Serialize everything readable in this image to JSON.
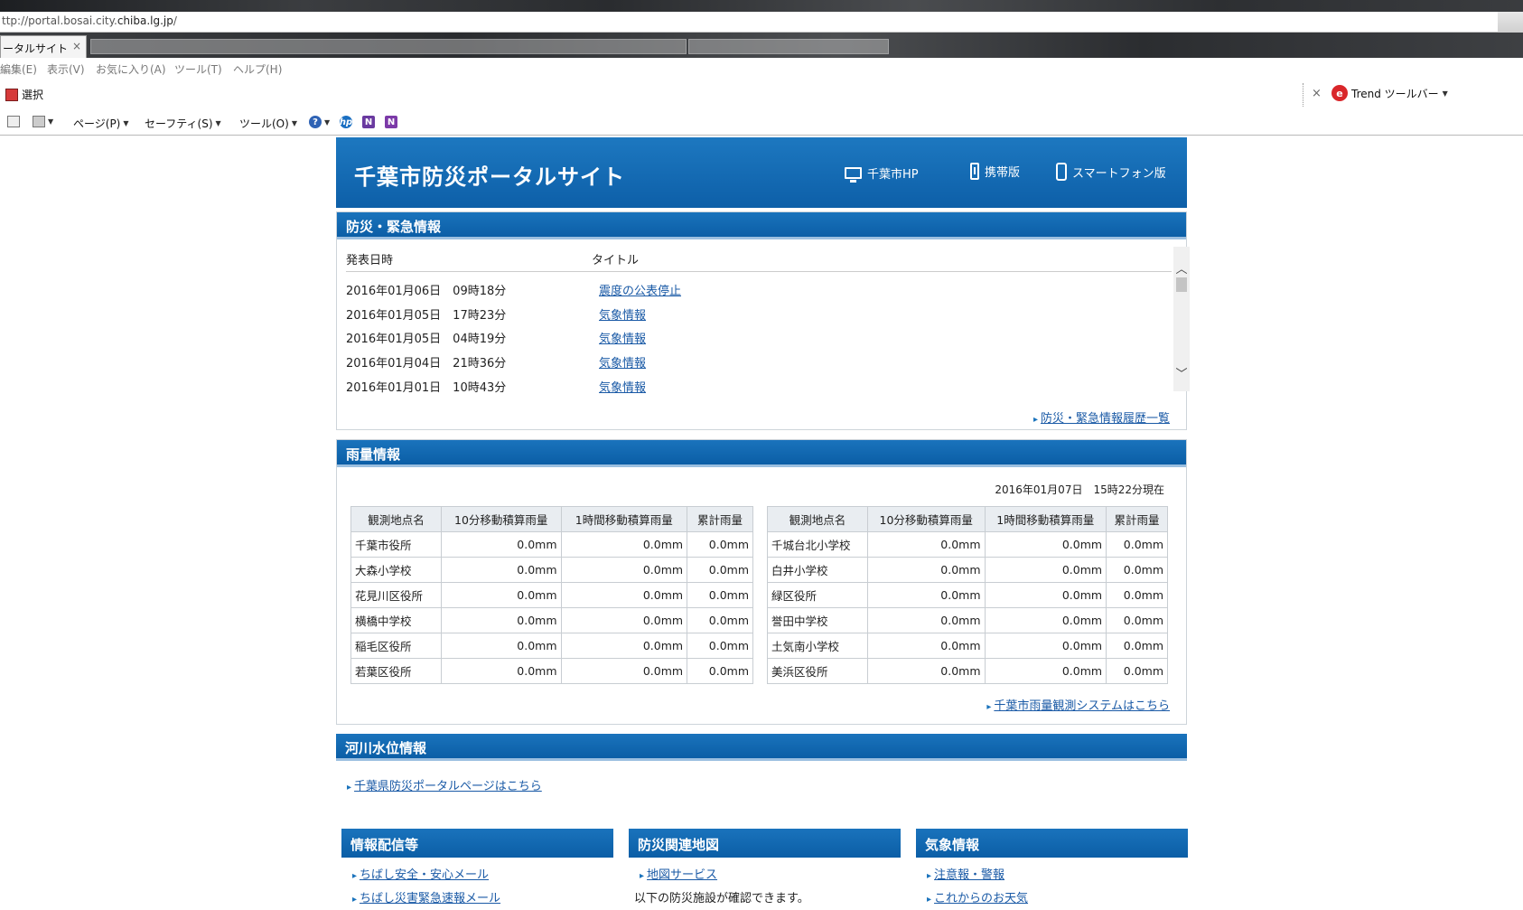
{
  "browser": {
    "url_prefix": "ttp://portal.bosai.city.",
    "url_host": "chiba.lg.jp",
    "url_suffix": "/",
    "tab_title": "ータルサイト",
    "tab_close": "×",
    "menu": [
      "編集(E)",
      "表示(V)",
      "お気に入り(A)",
      "ツール(T)",
      "ヘルプ(H)"
    ],
    "select_label": "選択",
    "close_x": "×",
    "trend_label": "Trend ツールバー",
    "cmd": {
      "page": "ページ(P)",
      "safety": "セーフティ(S)",
      "tools": "ツール(O)",
      "help": "?"
    }
  },
  "site": {
    "title": "千葉市防災ポータルサイト",
    "nav": {
      "hp": "千葉市HP",
      "mobile": "携帯版",
      "smartphone": "スマートフォン版"
    }
  },
  "emergency": {
    "heading": "防災・緊急情報",
    "col_date": "発表日時",
    "col_title": "タイトル",
    "rows": [
      {
        "date": "2016年01月06日　09時18分",
        "title": "震度の公表停止"
      },
      {
        "date": "2016年01月05日　17時23分",
        "title": "気象情報"
      },
      {
        "date": "2016年01月05日　04時19分",
        "title": "気象情報"
      },
      {
        "date": "2016年01月04日　21時36分",
        "title": "気象情報"
      },
      {
        "date": "2016年01月01日　10時43分",
        "title": "気象情報"
      }
    ],
    "more": "防災・緊急情報履歴一覧"
  },
  "rain": {
    "heading": "雨量情報",
    "timestamp": "2016年01月07日　15時22分現在",
    "headers": [
      "観測地点名",
      "10分移動積算雨量",
      "1時間移動積算雨量",
      "累計雨量"
    ],
    "left": [
      [
        "千葉市役所",
        "0.0mm",
        "0.0mm",
        "0.0mm"
      ],
      [
        "大森小学校",
        "0.0mm",
        "0.0mm",
        "0.0mm"
      ],
      [
        "花見川区役所",
        "0.0mm",
        "0.0mm",
        "0.0mm"
      ],
      [
        "横橋中学校",
        "0.0mm",
        "0.0mm",
        "0.0mm"
      ],
      [
        "稲毛区役所",
        "0.0mm",
        "0.0mm",
        "0.0mm"
      ],
      [
        "若葉区役所",
        "0.0mm",
        "0.0mm",
        "0.0mm"
      ]
    ],
    "right": [
      [
        "千城台北小学校",
        "0.0mm",
        "0.0mm",
        "0.0mm"
      ],
      [
        "白井小学校",
        "0.0mm",
        "0.0mm",
        "0.0mm"
      ],
      [
        "緑区役所",
        "0.0mm",
        "0.0mm",
        "0.0mm"
      ],
      [
        "誉田中学校",
        "0.0mm",
        "0.0mm",
        "0.0mm"
      ],
      [
        "土気南小学校",
        "0.0mm",
        "0.0mm",
        "0.0mm"
      ],
      [
        "美浜区役所",
        "0.0mm",
        "0.0mm",
        "0.0mm"
      ]
    ],
    "more": "千葉市雨量観測システムはこちら"
  },
  "river": {
    "heading": "河川水位情報",
    "link": "千葉県防災ポータルページはこちら"
  },
  "columns": {
    "info": {
      "heading": "情報配信等",
      "links": [
        "ちばし安全・安心メール",
        "ちばし災害緊急速報メール"
      ]
    },
    "map": {
      "heading": "防災関連地図",
      "link": "地図サービス",
      "note": "以下の防災施設が確認できます。"
    },
    "weather": {
      "heading": "気象情報",
      "links": [
        "注意報・警報",
        "これからのお天気"
      ]
    }
  }
}
